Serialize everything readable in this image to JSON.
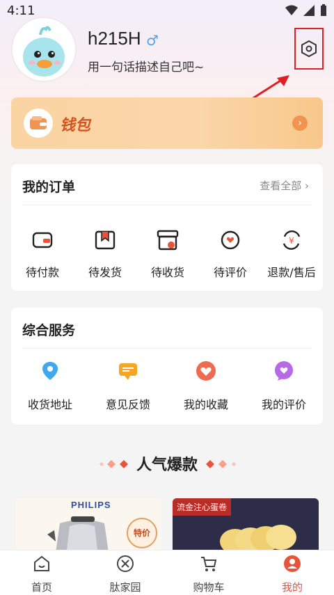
{
  "status_bar": {
    "time": "4:11"
  },
  "profile": {
    "username": "h215H",
    "gender_symbol": "♂",
    "bio": "用一句话描述自己吧~"
  },
  "wallet": {
    "label": "钱包",
    "arrow": "›"
  },
  "orders": {
    "title": "我的订单",
    "view_all": "查看全部 ›",
    "items": [
      {
        "label": "待付款",
        "icon": "wallet-icon"
      },
      {
        "label": "待发货",
        "icon": "package-icon"
      },
      {
        "label": "待收货",
        "icon": "delivery-box-icon"
      },
      {
        "label": "待评价",
        "icon": "review-icon"
      },
      {
        "label": "退款/售后",
        "icon": "refund-icon"
      }
    ]
  },
  "services": {
    "title": "综合服务",
    "items": [
      {
        "label": "收货地址",
        "icon": "location-pin-icon",
        "color": "#3fa8ef"
      },
      {
        "label": "意见反馈",
        "icon": "feedback-icon",
        "color": "#f5a623"
      },
      {
        "label": "我的收藏",
        "icon": "heart-icon",
        "color": "#f06a50"
      },
      {
        "label": "我的评价",
        "icon": "comment-heart-icon",
        "color": "#b76ae8"
      }
    ]
  },
  "popular": {
    "title": "人气爆款"
  },
  "products": [
    {
      "brand": "PHILIPS",
      "tag": "特价"
    },
    {
      "banner": "流金注心蛋卷"
    }
  ],
  "tabbar": {
    "items": [
      {
        "label": "首页",
        "icon": "home-icon"
      },
      {
        "label": "肽家园",
        "icon": "community-icon"
      },
      {
        "label": "购物车",
        "icon": "cart-icon"
      },
      {
        "label": "我的",
        "icon": "profile-icon",
        "active": true
      }
    ]
  },
  "colors": {
    "accent": "#e8543a",
    "annotation_red": "#e02020"
  }
}
